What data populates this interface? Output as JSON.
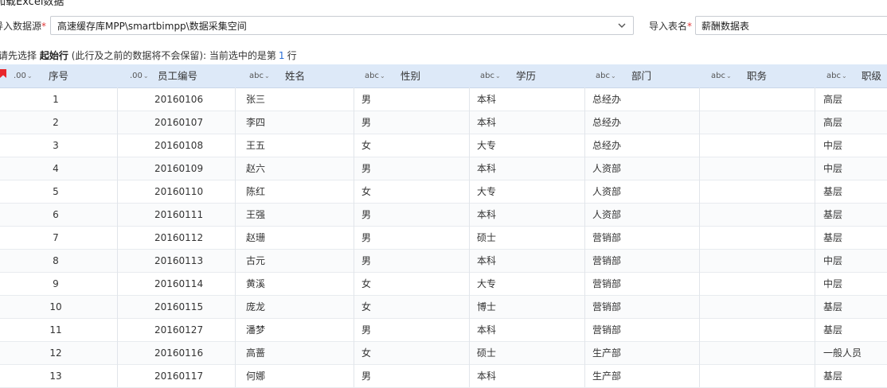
{
  "title": "加载Excel数据",
  "form": {
    "source_label": "导入数据源",
    "source_value": "高速缓存库MPP\\smartbimpp\\数据采集空间",
    "table_label": "导入表名",
    "table_value": "薪酬数据表",
    "required_mark": "*"
  },
  "hint": {
    "prefix": "请先选择",
    "bold": "起始行",
    "middle": "(此行及之前的数据将不会保留):  当前选中的是第",
    "current_row": "1",
    "suffix": "行"
  },
  "columns": [
    {
      "type": ".00",
      "name": "序号"
    },
    {
      "type": ".00",
      "name": "员工编号"
    },
    {
      "type": "abc",
      "name": "姓名"
    },
    {
      "type": "abc",
      "name": "性别"
    },
    {
      "type": "abc",
      "name": "学历"
    },
    {
      "type": "abc",
      "name": "部门"
    },
    {
      "type": "abc",
      "name": "职务"
    },
    {
      "type": "abc",
      "name": "职级"
    }
  ],
  "colors": {
    "header_bg": "#dde9f8",
    "flag": "#e8262b",
    "link_number": "#2b6fd6"
  },
  "rows": [
    [
      "1",
      "20160106",
      "张三",
      "男",
      "本科",
      "总经办",
      "",
      "高层"
    ],
    [
      "2",
      "20160107",
      "李四",
      "男",
      "本科",
      "总经办",
      "",
      "高层"
    ],
    [
      "3",
      "20160108",
      "王五",
      "女",
      "大专",
      "总经办",
      "",
      "中层"
    ],
    [
      "4",
      "20160109",
      "赵六",
      "男",
      "本科",
      "人资部",
      "",
      "中层"
    ],
    [
      "5",
      "20160110",
      "陈红",
      "女",
      "大专",
      "人资部",
      "",
      "基层"
    ],
    [
      "6",
      "20160111",
      "王强",
      "男",
      "本科",
      "人资部",
      "",
      "基层"
    ],
    [
      "7",
      "20160112",
      "赵珊",
      "男",
      "硕士",
      "营销部",
      "",
      "基层"
    ],
    [
      "8",
      "20160113",
      "古元",
      "男",
      "本科",
      "营销部",
      "",
      "中层"
    ],
    [
      "9",
      "20160114",
      "黄溪",
      "女",
      "大专",
      "营销部",
      "",
      "中层"
    ],
    [
      "10",
      "20160115",
      "庞龙",
      "女",
      "博士",
      "营销部",
      "",
      "基层"
    ],
    [
      "11",
      "20160127",
      "潘梦",
      "男",
      "本科",
      "营销部",
      "",
      "基层"
    ],
    [
      "12",
      "20160116",
      "高蔷",
      "女",
      "硕士",
      "生产部",
      "",
      "一般人员"
    ],
    [
      "13",
      "20160117",
      "何娜",
      "男",
      "本科",
      "生产部",
      "",
      "基层"
    ]
  ]
}
